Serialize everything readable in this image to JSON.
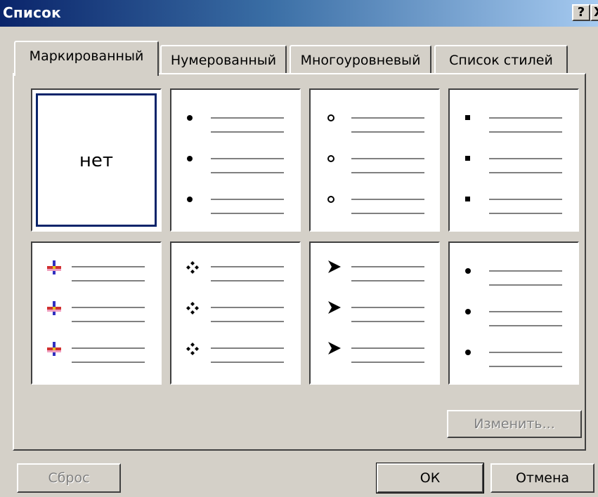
{
  "window": {
    "title": "Список",
    "help_label": "?",
    "close_label": "X"
  },
  "tabs": [
    {
      "label": "Маркированный",
      "active": true
    },
    {
      "label": "Нумерованный",
      "active": false
    },
    {
      "label": "Многоуровневый",
      "active": false
    },
    {
      "label": "Список стилей",
      "active": false
    }
  ],
  "gallery": {
    "none_label": "нет",
    "cells": [
      {
        "bullet": "none"
      },
      {
        "bullet": "dot"
      },
      {
        "bullet": "circle"
      },
      {
        "bullet": "square"
      },
      {
        "bullet": "picture-cross"
      },
      {
        "bullet": "four-diamond"
      },
      {
        "bullet": "arrowhead"
      },
      {
        "bullet": "dot"
      }
    ]
  },
  "buttons": {
    "modify_label": "Изменить...",
    "reset_label": "Сброс",
    "ok_label": "ОК",
    "cancel_label": "Отмена"
  },
  "colors": {
    "titlebar_start": "#0a246a",
    "titlebar_end": "#a6caf0",
    "face": "#d4d0c8",
    "selection": "#0a246a"
  }
}
